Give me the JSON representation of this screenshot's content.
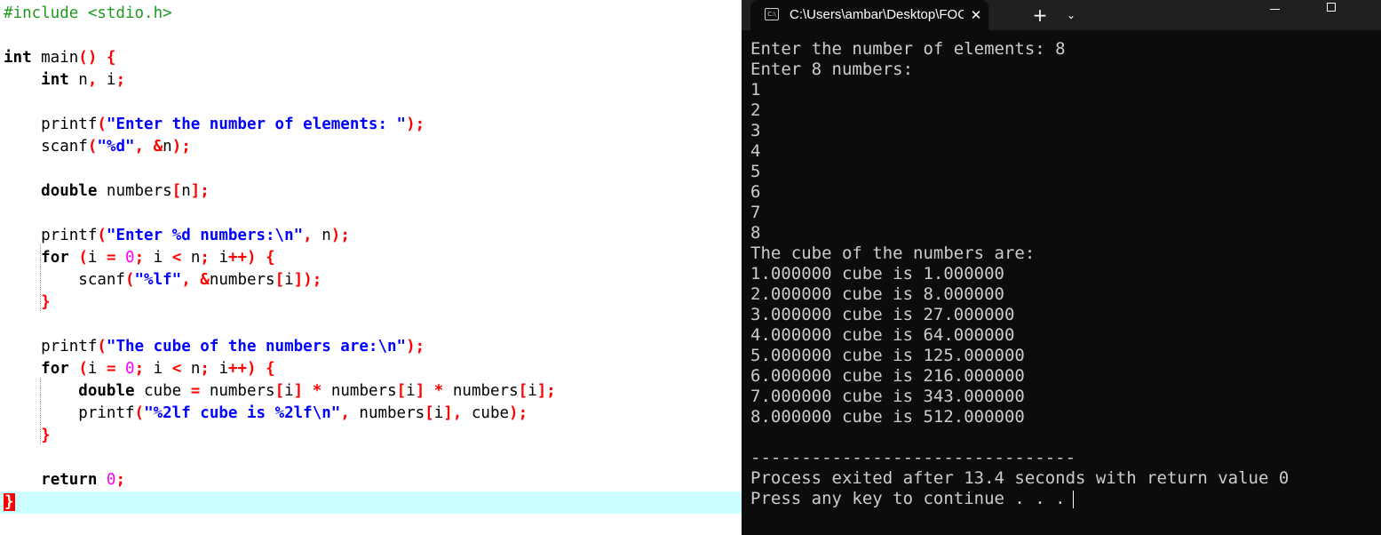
{
  "editor": {
    "current_line_index": 22,
    "lines": [
      [
        {
          "t": "#include <stdio.h>",
          "c": "pp"
        }
      ],
      [],
      [
        {
          "t": "int",
          "c": "kw"
        },
        {
          "t": " main"
        },
        {
          "t": "()",
          "c": "op"
        },
        {
          "t": " "
        },
        {
          "t": "{",
          "c": "op"
        }
      ],
      [
        {
          "t": "    "
        },
        {
          "t": "int",
          "c": "kw"
        },
        {
          "t": " n"
        },
        {
          "t": ",",
          "c": "op"
        },
        {
          "t": " i"
        },
        {
          "t": ";",
          "c": "op"
        }
      ],
      [],
      [
        {
          "t": "    printf"
        },
        {
          "t": "(",
          "c": "op"
        },
        {
          "t": "\"Enter the number of elements: \"",
          "c": "str"
        },
        {
          "t": ");",
          "c": "op"
        }
      ],
      [
        {
          "t": "    scanf"
        },
        {
          "t": "(",
          "c": "op"
        },
        {
          "t": "\"%d\"",
          "c": "str"
        },
        {
          "t": ",",
          "c": "op"
        },
        {
          "t": " "
        },
        {
          "t": "&",
          "c": "op"
        },
        {
          "t": "n"
        },
        {
          "t": ");",
          "c": "op"
        }
      ],
      [],
      [
        {
          "t": "    "
        },
        {
          "t": "double",
          "c": "kw"
        },
        {
          "t": " numbers"
        },
        {
          "t": "[",
          "c": "op"
        },
        {
          "t": "n"
        },
        {
          "t": "];",
          "c": "op"
        }
      ],
      [],
      [
        {
          "t": "    printf"
        },
        {
          "t": "(",
          "c": "op"
        },
        {
          "t": "\"Enter %d numbers:\\n\"",
          "c": "str"
        },
        {
          "t": ",",
          "c": "op"
        },
        {
          "t": " n"
        },
        {
          "t": ");",
          "c": "op"
        }
      ],
      [
        {
          "t": "    "
        },
        {
          "t": "for",
          "c": "kw"
        },
        {
          "t": " "
        },
        {
          "t": "(",
          "c": "op"
        },
        {
          "t": "i "
        },
        {
          "t": "=",
          "c": "op"
        },
        {
          "t": " "
        },
        {
          "t": "0",
          "c": "num"
        },
        {
          "t": ";",
          "c": "op"
        },
        {
          "t": " i "
        },
        {
          "t": "<",
          "c": "op"
        },
        {
          "t": " n"
        },
        {
          "t": ";",
          "c": "op"
        },
        {
          "t": " i"
        },
        {
          "t": "++)",
          "c": "op"
        },
        {
          "t": " "
        },
        {
          "t": "{",
          "c": "op"
        }
      ],
      [
        {
          "t": "        scanf"
        },
        {
          "t": "(",
          "c": "op"
        },
        {
          "t": "\"%lf\"",
          "c": "str"
        },
        {
          "t": ",",
          "c": "op"
        },
        {
          "t": " "
        },
        {
          "t": "&",
          "c": "op"
        },
        {
          "t": "numbers"
        },
        {
          "t": "[",
          "c": "op"
        },
        {
          "t": "i"
        },
        {
          "t": "]);",
          "c": "op"
        }
      ],
      [
        {
          "t": "    "
        },
        {
          "t": "}",
          "c": "op"
        }
      ],
      [],
      [
        {
          "t": "    printf"
        },
        {
          "t": "(",
          "c": "op"
        },
        {
          "t": "\"The cube of the numbers are:\\n\"",
          "c": "str"
        },
        {
          "t": ");",
          "c": "op"
        }
      ],
      [
        {
          "t": "    "
        },
        {
          "t": "for",
          "c": "kw"
        },
        {
          "t": " "
        },
        {
          "t": "(",
          "c": "op"
        },
        {
          "t": "i "
        },
        {
          "t": "=",
          "c": "op"
        },
        {
          "t": " "
        },
        {
          "t": "0",
          "c": "num"
        },
        {
          "t": ";",
          "c": "op"
        },
        {
          "t": " i "
        },
        {
          "t": "<",
          "c": "op"
        },
        {
          "t": " n"
        },
        {
          "t": ";",
          "c": "op"
        },
        {
          "t": " i"
        },
        {
          "t": "++)",
          "c": "op"
        },
        {
          "t": " "
        },
        {
          "t": "{",
          "c": "op"
        }
      ],
      [
        {
          "t": "        "
        },
        {
          "t": "double",
          "c": "kw"
        },
        {
          "t": " cube "
        },
        {
          "t": "=",
          "c": "op"
        },
        {
          "t": " numbers"
        },
        {
          "t": "[",
          "c": "op"
        },
        {
          "t": "i"
        },
        {
          "t": "]",
          "c": "op"
        },
        {
          "t": " "
        },
        {
          "t": "*",
          "c": "op"
        },
        {
          "t": " numbers"
        },
        {
          "t": "[",
          "c": "op"
        },
        {
          "t": "i"
        },
        {
          "t": "]",
          "c": "op"
        },
        {
          "t": " "
        },
        {
          "t": "*",
          "c": "op"
        },
        {
          "t": " numbers"
        },
        {
          "t": "[",
          "c": "op"
        },
        {
          "t": "i"
        },
        {
          "t": "];",
          "c": "op"
        }
      ],
      [
        {
          "t": "        printf"
        },
        {
          "t": "(",
          "c": "op"
        },
        {
          "t": "\"%2lf cube is %2lf\\n\"",
          "c": "str"
        },
        {
          "t": ",",
          "c": "op"
        },
        {
          "t": " numbers"
        },
        {
          "t": "[",
          "c": "op"
        },
        {
          "t": "i"
        },
        {
          "t": "],",
          "c": "op"
        },
        {
          "t": " cube"
        },
        {
          "t": ");",
          "c": "op"
        }
      ],
      [
        {
          "t": "    "
        },
        {
          "t": "}",
          "c": "op"
        }
      ],
      [],
      [
        {
          "t": "    "
        },
        {
          "t": "return",
          "c": "kw"
        },
        {
          "t": " "
        },
        {
          "t": "0",
          "c": "num"
        },
        {
          "t": ";",
          "c": "op"
        }
      ],
      [
        {
          "t": "}",
          "c": "cur"
        }
      ]
    ]
  },
  "terminal": {
    "tab_icon": "C:\\",
    "tab_title": "C:\\Users\\ambar\\Desktop\\FOC",
    "close_glyph": "✕",
    "new_tab_glyph": "+",
    "dropdown_glyph": "⌄",
    "background": "#0c0c0c",
    "text_color": "#cccccc",
    "lines": [
      "Enter the number of elements: 8",
      "Enter 8 numbers:",
      "1",
      "2",
      "3",
      "4",
      "5",
      "6",
      "7",
      "8",
      "The cube of the numbers are:",
      "1.000000 cube is 1.000000",
      "2.000000 cube is 8.000000",
      "3.000000 cube is 27.000000",
      "4.000000 cube is 64.000000",
      "5.000000 cube is 125.000000",
      "6.000000 cube is 216.000000",
      "7.000000 cube is 343.000000",
      "8.000000 cube is 512.000000",
      "",
      "--------------------------------",
      "Process exited after 13.4 seconds with return value 0",
      "Press any key to continue . . ."
    ]
  }
}
